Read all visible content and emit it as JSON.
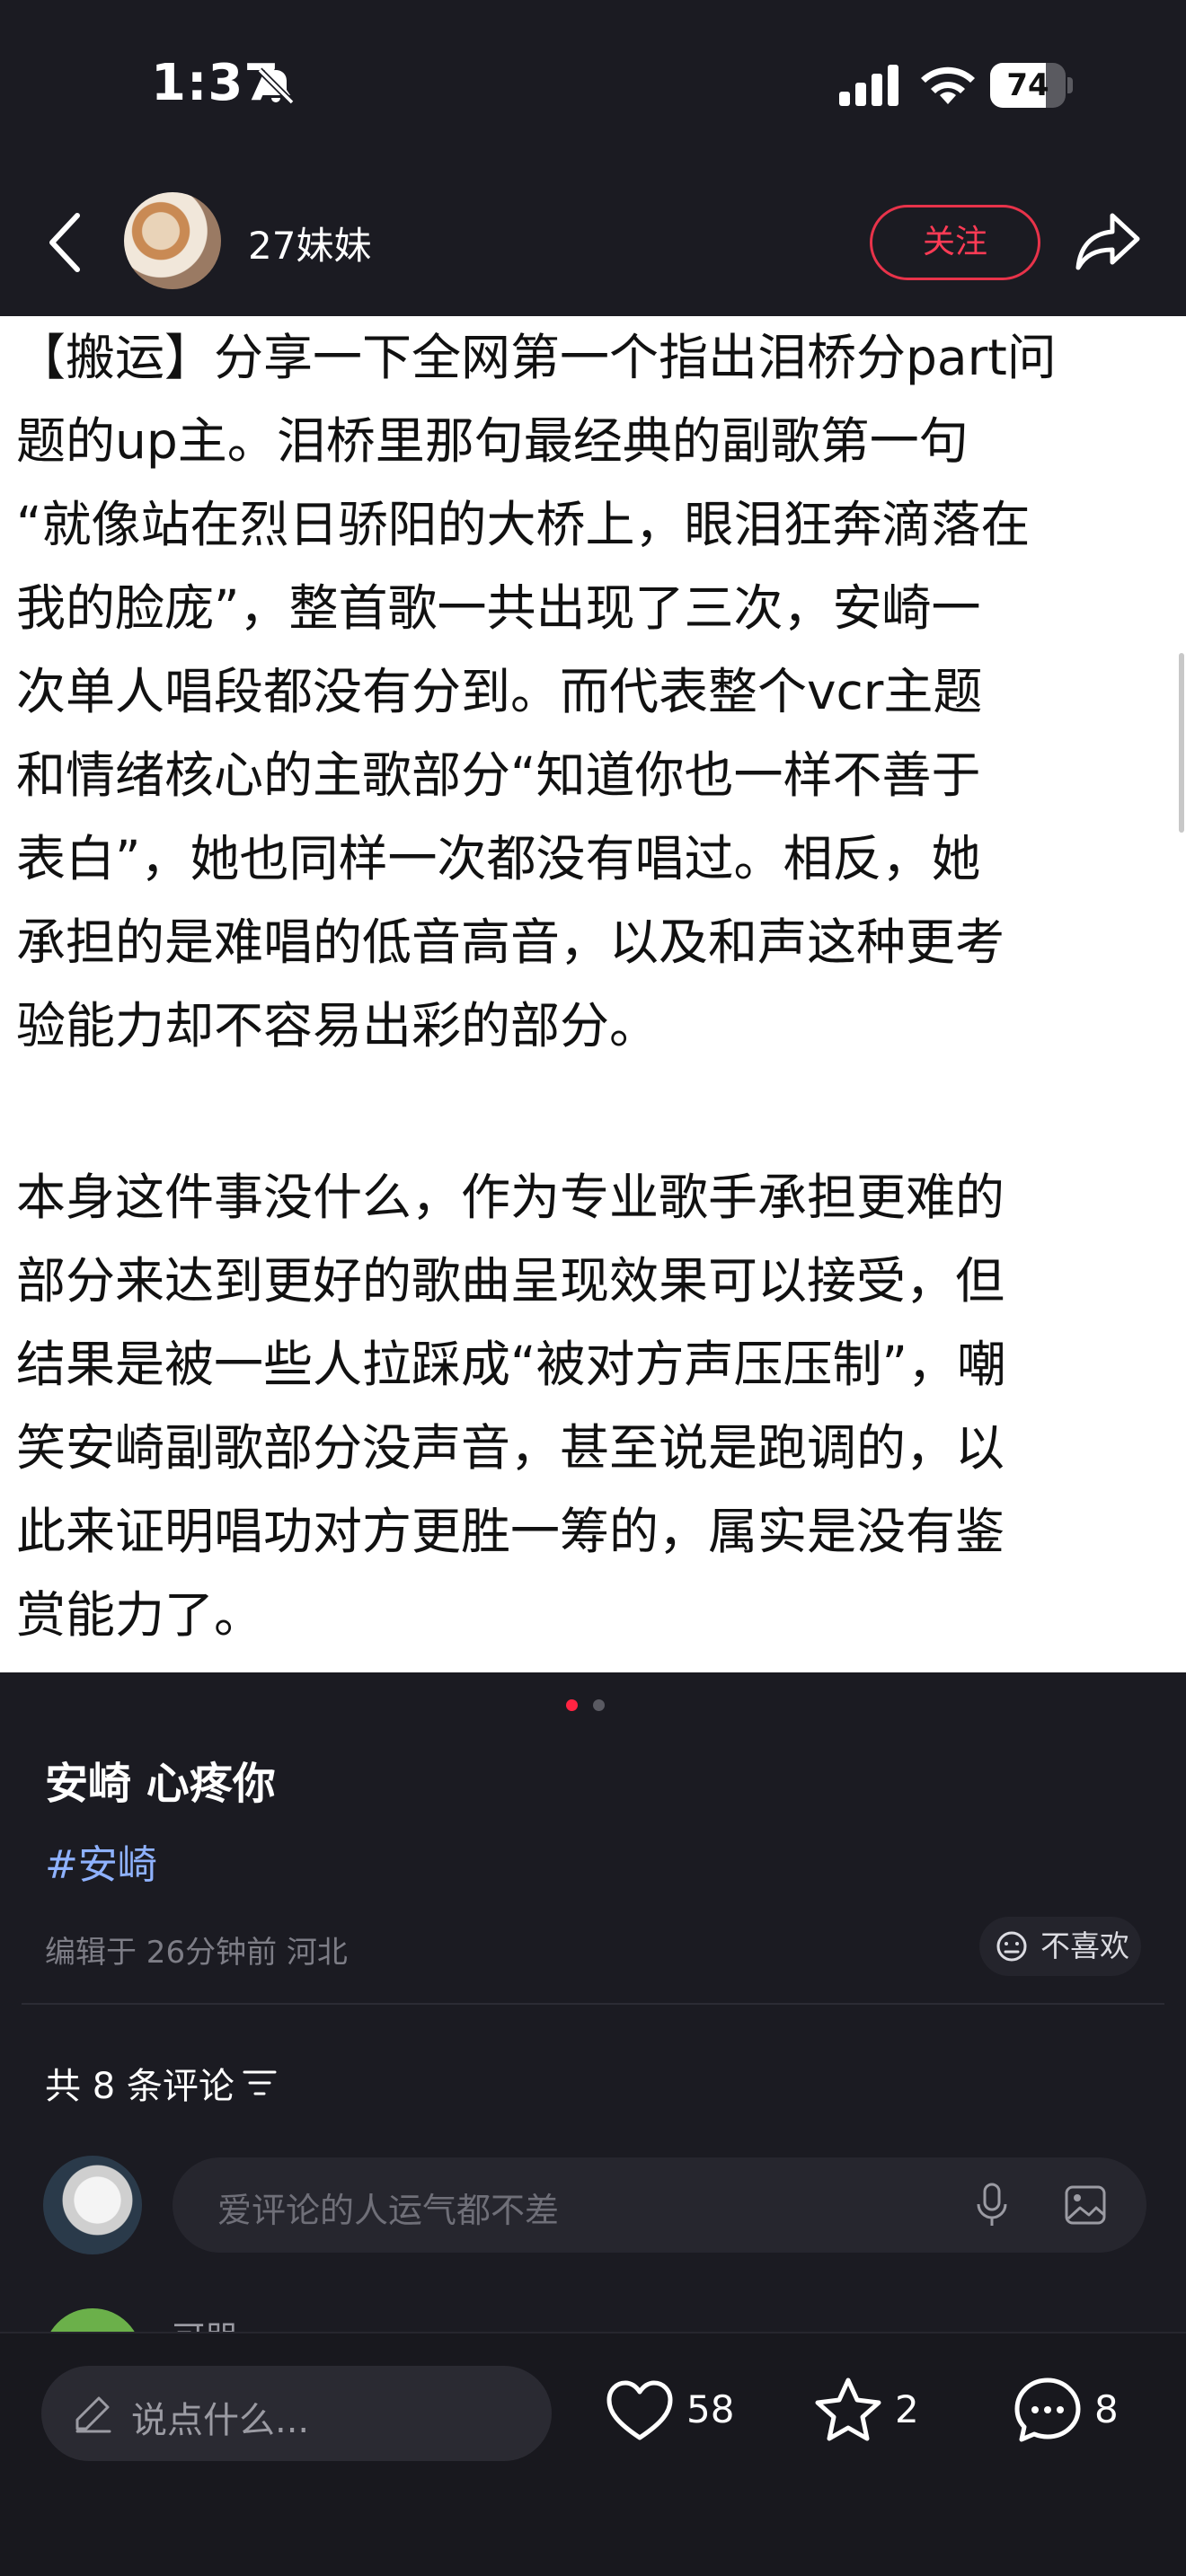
{
  "status_bar": {
    "time": "1:37",
    "battery_level": "74",
    "battery_fraction": 0.74,
    "icons": [
      "bell-off-icon",
      "signal-icon",
      "wifi-icon",
      "battery-icon"
    ]
  },
  "header": {
    "username": "27妹妹",
    "follow_label": "关注",
    "icons": [
      "back-icon",
      "share-icon"
    ]
  },
  "post_image": {
    "paragraphs": [
      [
        "【搬运】分享一下全网第一个指出泪桥分part问",
        "题的up主。泪桥里那句最经典的副歌第一句",
        "“就像站在烈日骄阳的大桥上，眼泪狂奔滴落在",
        "我的脸庞”，整首歌一共出现了三次，安崎一",
        "次单人唱段都没有分到。而代表整个vcr主题",
        "和情绪核心的主歌部分“知道你也一样不善于",
        "表白”，她也同样一次都没有唱过。相反，她",
        "承担的是难唱的低音高音，以及和声这种更考",
        "验能力却不容易出彩的部分。"
      ],
      [
        "本身这件事没什么，作为专业歌手承担更难的",
        "部分来达到更好的歌曲呈现效果可以接受，但",
        "结果是被一些人拉踩成“被对方声压压制”，嘲",
        "笑安崎副歌部分没声音，甚至说是跑调的，以",
        "此来证明唱功对方更胜一筹的，属实是没有鉴",
        "赏能力了。"
      ]
    ],
    "carousel_current": 1,
    "carousel_total": 2
  },
  "caption": {
    "title": "安崎 心疼你",
    "hashtag": "#安崎",
    "edited_info": "编辑于 26分钟前 河北",
    "dislike_label": "不喜欢"
  },
  "comments": {
    "count_label": "共 8 条评论",
    "input_placeholder": "爱评论的人运气都不差",
    "next_commenter": "可朋"
  },
  "bottom_bar": {
    "say_placeholder": "说点什么...",
    "likes": "58",
    "collects": "2",
    "comments": "8"
  },
  "colors": {
    "accent": "#ff2442",
    "background": "#1b1b22",
    "hashtag": "#8fb2ff"
  }
}
